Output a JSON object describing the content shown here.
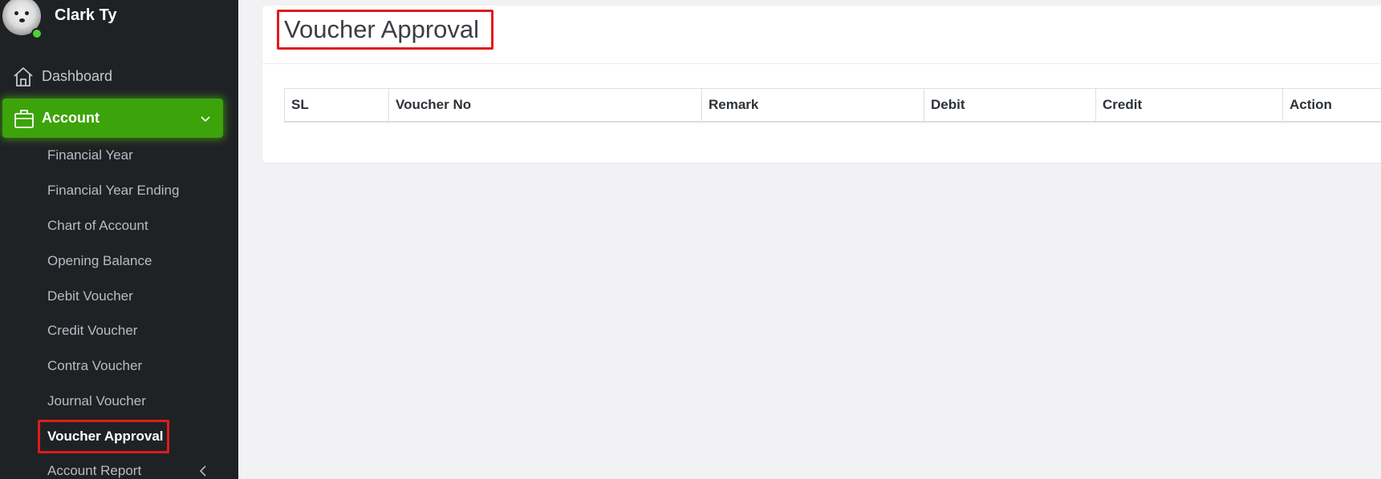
{
  "user": {
    "name": "Clark Ty",
    "status_color": "#4cd137"
  },
  "sidebar": {
    "dashboard": {
      "label": "Dashboard",
      "icon": "home-icon"
    },
    "account": {
      "label": "Account",
      "icon": "briefcase-icon",
      "expanded": true,
      "accent_color": "#3ca30a"
    },
    "submenu": [
      {
        "label": "Financial Year"
      },
      {
        "label": "Financial Year Ending"
      },
      {
        "label": "Chart of Account"
      },
      {
        "label": "Opening Balance"
      },
      {
        "label": "Debit Voucher"
      },
      {
        "label": "Credit Voucher"
      },
      {
        "label": "Contra Voucher"
      },
      {
        "label": "Journal Voucher"
      },
      {
        "label": "Voucher Approval",
        "active": true
      },
      {
        "label": "Account Report",
        "has_children": true
      }
    ]
  },
  "main": {
    "title": "Voucher Approval",
    "table": {
      "columns": [
        "SL",
        "Voucher No",
        "Remark",
        "Debit",
        "Credit",
        "Action"
      ],
      "rows": []
    }
  },
  "highlight_color": "#e01b1b"
}
